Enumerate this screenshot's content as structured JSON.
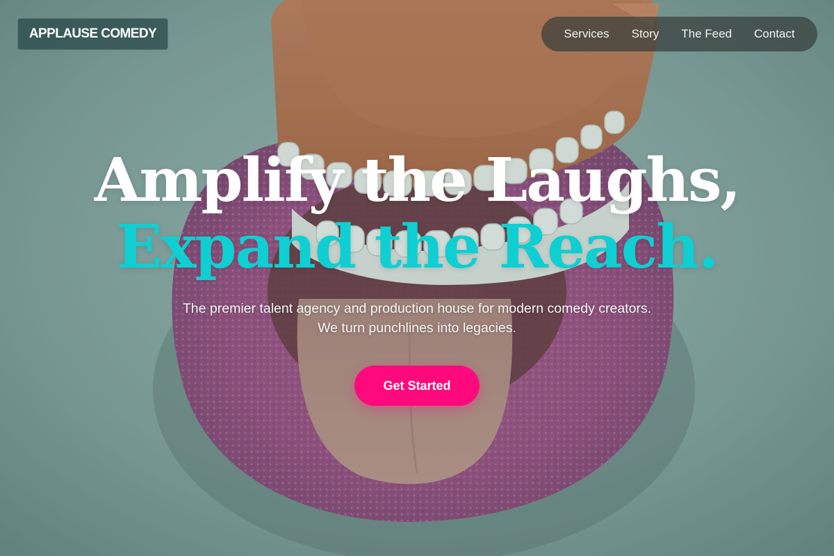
{
  "brand": {
    "name": "APPLAUSE COMEDY"
  },
  "nav": {
    "items": [
      {
        "label": "Services"
      },
      {
        "label": "Story"
      },
      {
        "label": "The Feed"
      },
      {
        "label": "Contact"
      }
    ]
  },
  "hero": {
    "headline_line_1": "Amplify the Laughs,",
    "headline_line_2": "Expand the Reach.",
    "subtext": "The premier talent agency and production house for modern comedy creators. We turn punchlines into legacies.",
    "cta_label": "Get Started"
  },
  "colors": {
    "accent_teal": "#0fcfd2",
    "cta_pink": "#ff0a7d",
    "headline_white": "#ffffff"
  }
}
